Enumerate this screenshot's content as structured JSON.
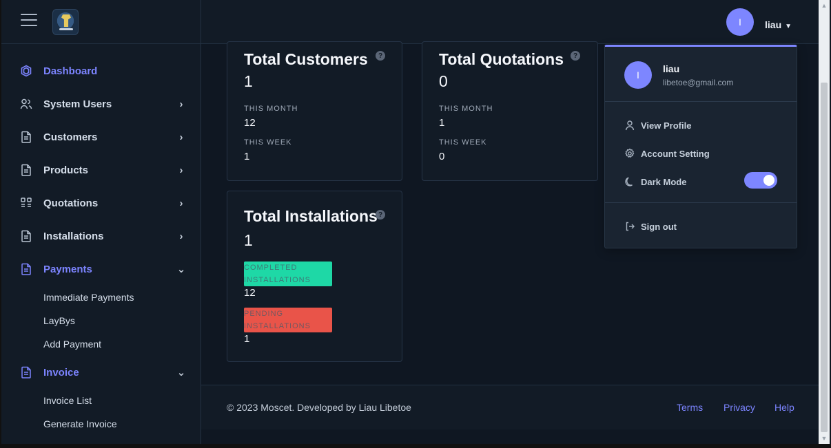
{
  "top": {
    "username": "liau",
    "avatar_initial": "I"
  },
  "sidebar": {
    "items": [
      {
        "label": "Dashboard",
        "icon": "dashboard-icon",
        "active": true,
        "chevron": ""
      },
      {
        "label": "System Users",
        "icon": "users-icon",
        "active": false,
        "chevron": "›"
      },
      {
        "label": "Customers",
        "icon": "document-icon",
        "active": false,
        "chevron": "›"
      },
      {
        "label": "Products",
        "icon": "document-icon",
        "active": false,
        "chevron": "›"
      },
      {
        "label": "Quotations",
        "icon": "grid-icon",
        "active": false,
        "chevron": "›"
      },
      {
        "label": "Installations",
        "icon": "document-icon",
        "active": false,
        "chevron": "›"
      },
      {
        "label": "Payments",
        "icon": "document-icon",
        "active": true,
        "chevron": "⌄"
      },
      {
        "label": "Invoice",
        "icon": "document-icon",
        "active": true,
        "chevron": "⌄"
      }
    ],
    "payments_sub": [
      "Immediate Payments",
      "LayBys",
      "Add Payment"
    ],
    "invoice_sub": [
      "Invoice List",
      "Generate Invoice"
    ]
  },
  "cards": {
    "customers": {
      "title": "Total Customers",
      "help": "?",
      "total": "1",
      "month_label": "THIS MONTH",
      "month_value": "12",
      "week_label": "THIS WEEK",
      "week_value": "1"
    },
    "quotations": {
      "title": "Total Quotations",
      "help": "?",
      "total": "0",
      "month_label": "THIS MONTH",
      "month_value": "1",
      "week_label": "THIS WEEK",
      "week_value": "0"
    },
    "installations": {
      "title": "Total Installations",
      "help": "?",
      "total": "1",
      "completed_label_1": "COMPLETED",
      "completed_label_2": "INSTALLATIONS",
      "completed_value": "12",
      "pending_label_1": "PENDING",
      "pending_label_2": "INSTALLATIONS",
      "pending_value": "1"
    }
  },
  "dropdown": {
    "name": "liau",
    "email": "libetoe@gmail.com",
    "view_profile": "View Profile",
    "account_setting": "Account Setting",
    "dark_mode": "Dark Mode",
    "dark_mode_enabled": true,
    "sign_out": "Sign out"
  },
  "footer": {
    "copyright": "© 2023 Moscet. Developed by Liau Libetoe",
    "terms": "Terms",
    "privacy": "Privacy",
    "help": "Help"
  },
  "colors": {
    "accent": "#7d86ff",
    "sidebar_bg": "#121b26",
    "content_bg": "#0f1722",
    "success": "#1ed8a6",
    "danger": "#e95449"
  }
}
